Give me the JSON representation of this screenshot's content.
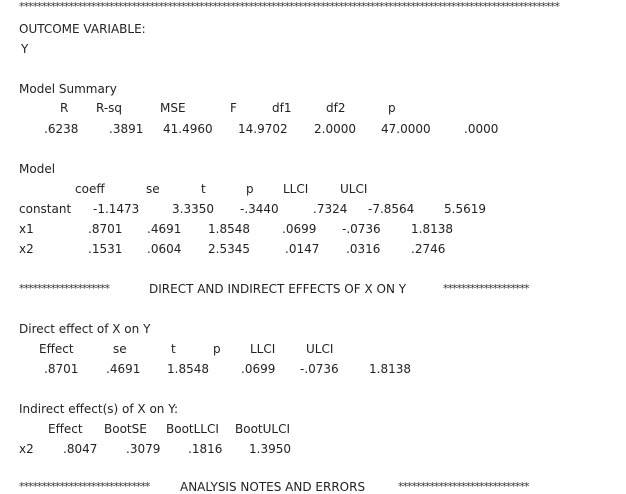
{
  "top_rule": "************************************************************************************************************************",
  "outcome": {
    "label": "OUTCOME VARIABLE:",
    "value": "Y"
  },
  "model_summary": {
    "title": "Model Summary",
    "headers": [
      "R",
      "R-sq",
      "MSE",
      "F",
      "df1",
      "df2",
      "p"
    ],
    "values": [
      ".6238",
      ".3891",
      "41.4960",
      "14.9702",
      "2.0000",
      "47.0000",
      ".0000"
    ]
  },
  "model": {
    "title": "Model",
    "headers": [
      "coeff",
      "se",
      "t",
      "p",
      "LLCI",
      "ULCI"
    ],
    "rows": [
      {
        "name": "constant",
        "cells": [
          "-1.1473",
          "3.3350",
          "-.3440",
          ".7324",
          "-7.8564",
          "5.5619"
        ]
      },
      {
        "name": "x1",
        "cells": [
          ".8701",
          ".4691",
          "1.8548",
          ".0699",
          "-.0736",
          "1.8138"
        ]
      },
      {
        "name": "x2",
        "cells": [
          ".1531",
          ".0604",
          "2.5345",
          ".0147",
          ".0316",
          ".2746"
        ]
      }
    ]
  },
  "section_direct_indirect": {
    "stars_left": "********************",
    "label": "DIRECT AND INDIRECT EFFECTS OF X ON Y",
    "stars_right": "*******************"
  },
  "direct": {
    "title": "Direct effect of X on Y",
    "headers": [
      "Effect",
      "se",
      "t",
      "p",
      "LLCI",
      "ULCI"
    ],
    "values": [
      ".8701",
      ".4691",
      "1.8548",
      ".0699",
      "-.0736",
      "1.8138"
    ]
  },
  "indirect": {
    "title": "Indirect effect(s) of X on Y:",
    "headers": [
      "Effect",
      "BootSE",
      "BootLLCI",
      "BootULCI"
    ],
    "row": {
      "name": "x2",
      "cells": [
        ".8047",
        ".3079",
        ".1816",
        "1.3950"
      ]
    }
  },
  "section_notes": {
    "stars_left": "*****************************",
    "label": "ANALYSIS NOTES AND ERRORS",
    "stars_right": "*****************************"
  }
}
